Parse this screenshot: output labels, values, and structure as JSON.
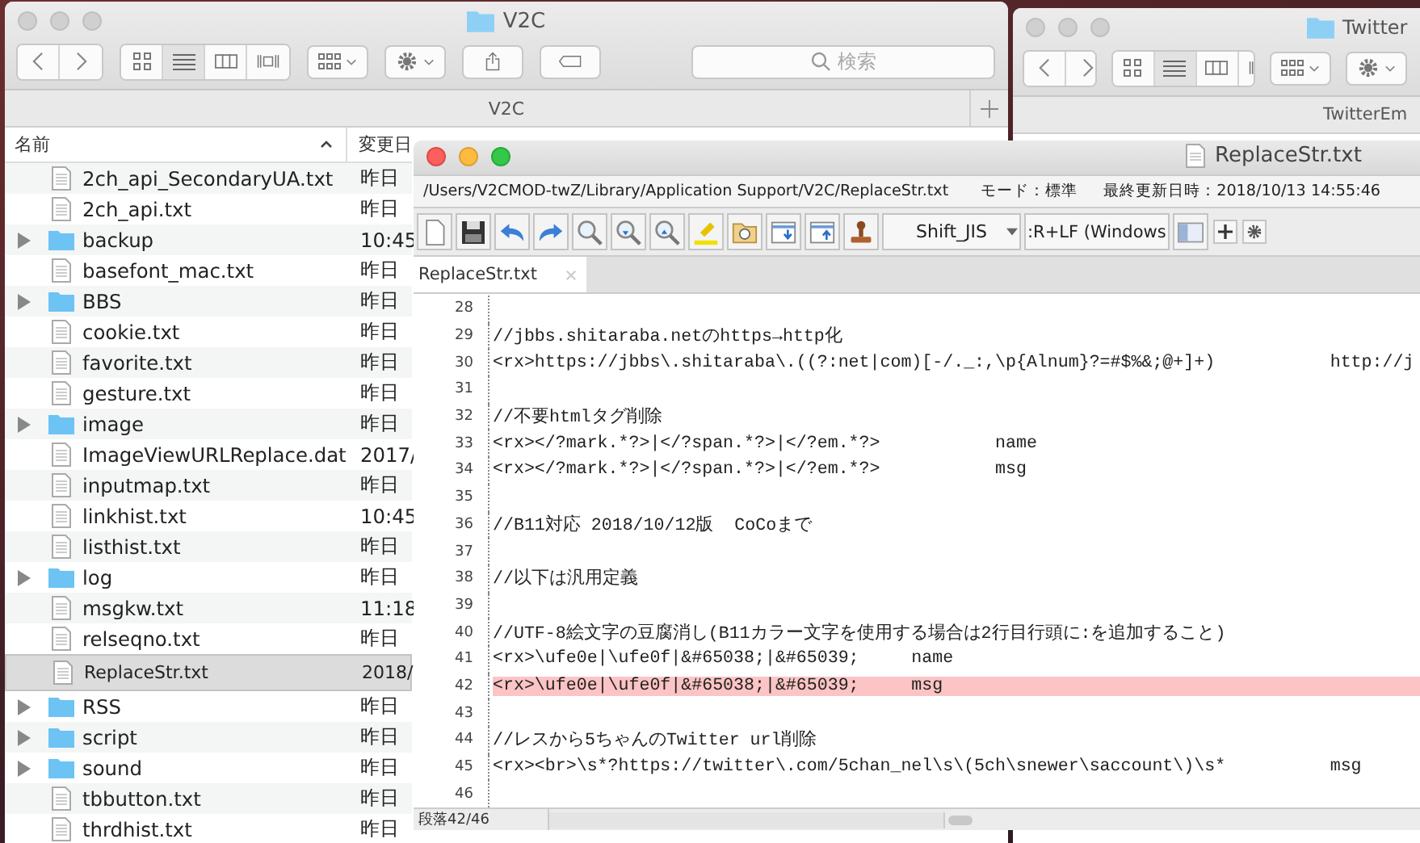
{
  "finder": {
    "title": "V2C",
    "search": {
      "placeholder": "検索"
    },
    "path": "V2C",
    "columns": [
      {
        "label": "名前",
        "sorted": true
      },
      {
        "label": "変更日",
        "sorted": false
      }
    ],
    "rows": [
      {
        "name": "2ch_api_SecondaryUA.txt",
        "kind": "file",
        "date": "昨日",
        "selected": false
      },
      {
        "name": "2ch_api.txt",
        "kind": "file",
        "date": "昨日",
        "selected": false
      },
      {
        "name": "backup",
        "kind": "folder",
        "date": "10:45",
        "selected": false
      },
      {
        "name": "basefont_mac.txt",
        "kind": "file",
        "date": "昨日",
        "selected": false
      },
      {
        "name": "BBS",
        "kind": "folder",
        "date": "昨日",
        "selected": false
      },
      {
        "name": "cookie.txt",
        "kind": "file",
        "date": "昨日",
        "selected": false
      },
      {
        "name": "favorite.txt",
        "kind": "file",
        "date": "昨日",
        "selected": false
      },
      {
        "name": "gesture.txt",
        "kind": "file",
        "date": "昨日",
        "selected": false
      },
      {
        "name": "image",
        "kind": "folder",
        "date": "昨日",
        "selected": false
      },
      {
        "name": "ImageViewURLReplace.dat",
        "kind": "file",
        "date": "2017/",
        "selected": false
      },
      {
        "name": "inputmap.txt",
        "kind": "file",
        "date": "昨日",
        "selected": false
      },
      {
        "name": "linkhist.txt",
        "kind": "file",
        "date": "10:45",
        "selected": false
      },
      {
        "name": "listhist.txt",
        "kind": "file",
        "date": "昨日",
        "selected": false
      },
      {
        "name": "log",
        "kind": "folder",
        "date": "昨日",
        "selected": false
      },
      {
        "name": "msgkw.txt",
        "kind": "file",
        "date": "11:18",
        "selected": false
      },
      {
        "name": "relseqno.txt",
        "kind": "file",
        "date": "昨日",
        "selected": false
      },
      {
        "name": "ReplaceStr.txt",
        "kind": "file",
        "date": "2018/",
        "selected": true
      },
      {
        "name": "RSS",
        "kind": "folder",
        "date": "昨日",
        "selected": false
      },
      {
        "name": "script",
        "kind": "folder",
        "date": "昨日",
        "selected": false
      },
      {
        "name": "sound",
        "kind": "folder",
        "date": "昨日",
        "selected": false
      },
      {
        "name": "tbbutton.txt",
        "kind": "file",
        "date": "昨日",
        "selected": false
      },
      {
        "name": "thrdhist.txt",
        "kind": "file",
        "date": "昨日",
        "selected": false
      }
    ]
  },
  "finder2": {
    "title": "Twitter",
    "path": "TwitterEm"
  },
  "editor": {
    "title": "ReplaceStr.txt",
    "path": "/Users/V2CMOD-twZ/Library/Application Support/V2C/ReplaceStr.txt",
    "mode": "モード：標準",
    "modified": "最終更新日時：2018/10/13 14:55:46",
    "encoding": "Shift_JIS",
    "line_ending": ":R+LF (Windows",
    "tabs": [
      {
        "label": "ReplaceStr.txt",
        "selected": true
      }
    ],
    "lines": [
      {
        "number": "28",
        "highlighted": false
      },
      {
        "number": "29",
        "text": "//jbbs.shitaraba.netのhttps→http化",
        "highlighted": false
      },
      {
        "number": "30",
        "text": "<rx>https://jbbs\\.shitaraba\\.((?:net|com)[-/._:,\\p{Alnum}?=#$%&;@+]+)\t\thttp://j",
        "highlighted": false
      },
      {
        "number": "31",
        "highlighted": false
      },
      {
        "number": "32",
        "text": "//不要htmlタグ削除",
        "highlighted": false
      },
      {
        "number": "33",
        "text": "<rx></?mark.*?>|</?span.*?>|</?em.*?>\t\tname",
        "highlighted": false
      },
      {
        "number": "34",
        "text": "<rx></?mark.*?>|</?span.*?>|</?em.*?>\t\tmsg",
        "highlighted": false
      },
      {
        "number": "35",
        "highlighted": false
      },
      {
        "number": "36",
        "text": "//B11対応 2018/10/12版  CoCoまで",
        "highlighted": false
      },
      {
        "number": "37",
        "highlighted": false
      },
      {
        "number": "38",
        "text": "//以下は汎用定義",
        "highlighted": false
      },
      {
        "number": "39",
        "highlighted": false
      },
      {
        "number": "40",
        "text": "//UTF-8絵文字の豆腐消し(B11カラー文字を使用する場合は2行目行頭に:を追加すること)",
        "highlighted": false
      },
      {
        "number": "41",
        "text": "<rx>\\ufe0e|\\ufe0f|&#65038;|&#65039;\tname",
        "highlighted": false
      },
      {
        "number": "42",
        "text": "<rx>\\ufe0e|\\ufe0f|&#65038;|&#65039;\tmsg",
        "highlighted": true
      },
      {
        "number": "43",
        "highlighted": false
      },
      {
        "number": "44",
        "text": "//レスから5ちゃんのTwitter url削除",
        "highlighted": false
      },
      {
        "number": "45",
        "text": "<rx><br>\\s*?https://twitter\\.com/5chan_nel\\s\\(5ch\\snewer\\saccount\\)\\s*\t\tmsg",
        "highlighted": false
      },
      {
        "number": "46",
        "highlighted": false
      }
    ],
    "status": "段落42/46"
  }
}
